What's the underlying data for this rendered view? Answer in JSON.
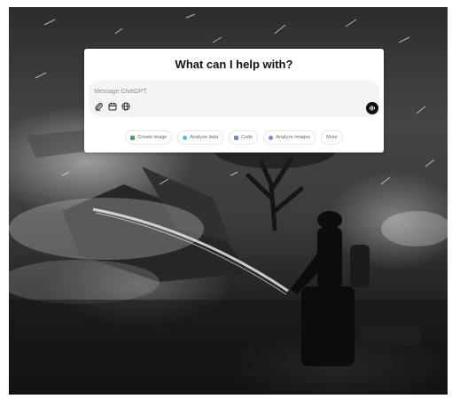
{
  "background": {
    "photo_icon": "firefighter-night-scene"
  },
  "dialog": {
    "title": "What can I help with?",
    "composer": {
      "placeholder": "Message ChatGPT",
      "value": "",
      "tools": [
        {
          "icon": "paperclip-icon"
        },
        {
          "icon": "calendar-icon"
        },
        {
          "icon": "globe-icon"
        }
      ],
      "voice_icon": "voice-mode-icon"
    },
    "suggestions": [
      {
        "label": "Create image",
        "color": "#3aa757"
      },
      {
        "label": "Analyze data",
        "color": "#5bb7e3"
      },
      {
        "label": "Code",
        "color": "#7a86c9"
      },
      {
        "label": "Analyze images",
        "color": "#9d7ad1"
      },
      {
        "label": "More",
        "color": ""
      }
    ]
  }
}
